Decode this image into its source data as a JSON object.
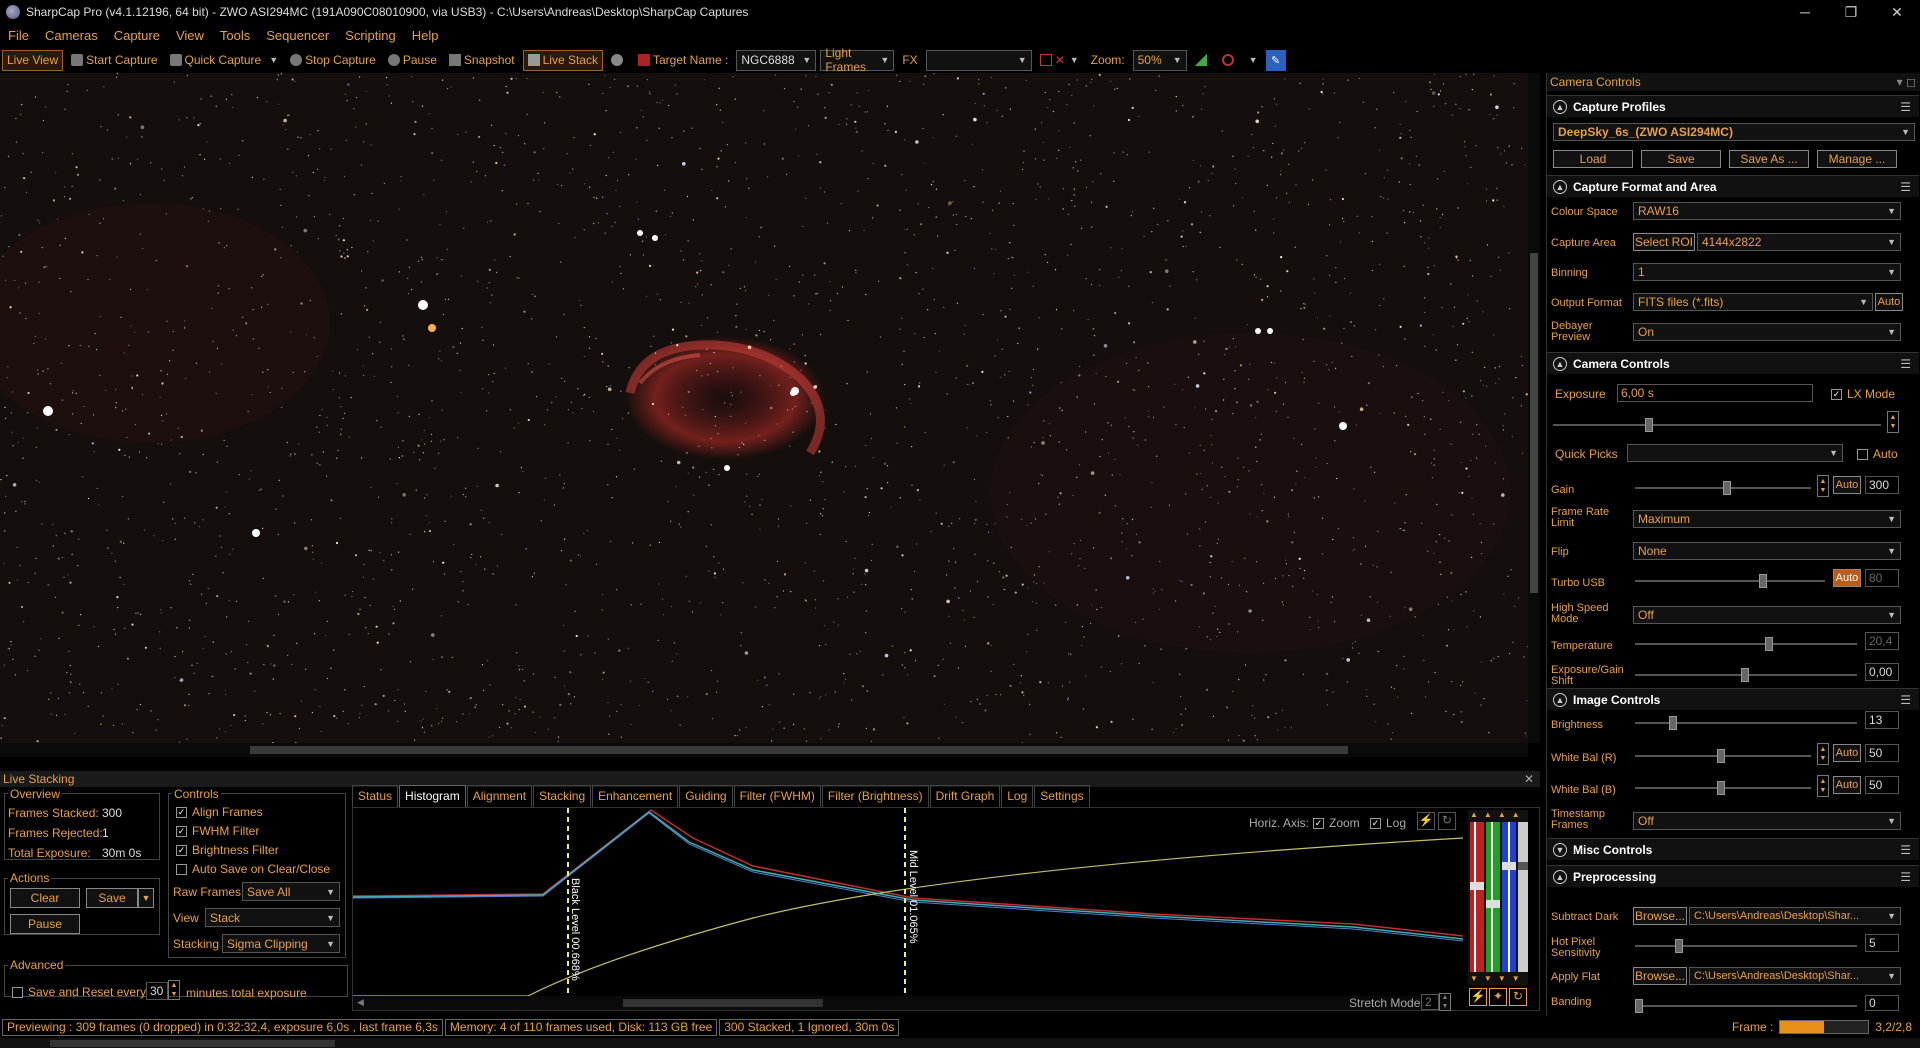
{
  "window": {
    "title": "SharpCap Pro (v4.1.12196, 64 bit) - ZWO ASI294MC (191A090C08010900, via USB3) - C:\\Users\\Andreas\\Desktop\\SharpCap Captures",
    "minimize": "─",
    "maximize": "❐",
    "close": "✕"
  },
  "menu": [
    "File",
    "Cameras",
    "Capture",
    "View",
    "Tools",
    "Sequencer",
    "Scripting",
    "Help"
  ],
  "toolbar": {
    "live_view": "Live View",
    "start_capture": "Start Capture",
    "quick_capture": "Quick Capture",
    "stop_capture": "Stop Capture",
    "pause": "Pause",
    "snapshot": "Snapshot",
    "live_stack": "Live Stack",
    "target_label": "Target Name :",
    "target_value": "NGC6888",
    "frame_type": "Light Frames",
    "fx_label": "FX",
    "fx_value": "",
    "zoom_label": "Zoom:",
    "zoom_value": "50%"
  },
  "live_stacking": {
    "header": "Live Stacking",
    "overview": {
      "title": "Overview",
      "frames_stacked_label": "Frames Stacked:",
      "frames_stacked": "300",
      "frames_rejected_label": "Frames Rejected:",
      "frames_rejected": "1",
      "total_exposure_label": "Total Exposure:",
      "total_exposure": "30m 0s"
    },
    "actions": {
      "title": "Actions",
      "clear": "Clear",
      "save": "Save",
      "pause": "Pause"
    },
    "advanced": {
      "title": "Advanced",
      "save_reset_label": "Save and Reset every",
      "minutes": "30",
      "minutes_label": "minutes total exposure"
    },
    "controls": {
      "title": "Controls",
      "align": "Align Frames",
      "align_checked": true,
      "fwhm": "FWHM Filter",
      "fwhm_checked": true,
      "brightness": "Brightness Filter",
      "brightness_checked": true,
      "autosave": "Auto Save on Clear/Close",
      "autosave_checked": false,
      "raw_frames_label": "Raw Frames",
      "raw_frames": "Save All",
      "view_label": "View",
      "view": "Stack",
      "stacking_label": "Stacking",
      "stacking": "Sigma Clipping"
    },
    "tabs": [
      "Status",
      "Histogram",
      "Alignment",
      "Stacking",
      "Enhancement",
      "Guiding",
      "Filter (FWHM)",
      "Filter (Brightness)",
      "Drift Graph",
      "Log",
      "Settings"
    ],
    "selected_tab": "Histogram",
    "histogram": {
      "horiz_axis_label": "Horiz. Axis:",
      "zoom": "Zoom",
      "zoom_checked": true,
      "log": "Log",
      "log_checked": true,
      "black_level": "Black Level 00.668%",
      "mid_level": "Mid Level 01.065%",
      "stretch_mode_label": "Stretch Mode",
      "stretch_mode": "2"
    }
  },
  "status": {
    "previewing": "Previewing : 309 frames (0 dropped) in 0:32:32,4, exposure 6,0s , last frame 6,3s",
    "memory": "Memory: 4 of 110 frames used, Disk: 113 GB free",
    "stacked": "300 Stacked, 1 Ignored, 30m 0s",
    "frame_label": "Frame :",
    "frame_value": "3,2/2,8",
    "frame_progress": 0.5
  },
  "camera_panel": {
    "header": "Camera Controls",
    "capture_profiles": {
      "title": "Capture Profiles",
      "profile": "DeepSky_6s_(ZWO ASI294MC)",
      "load": "Load",
      "save": "Save",
      "save_as": "Save As ...",
      "manage": "Manage ..."
    },
    "format": {
      "title": "Capture Format and Area",
      "colour_space_label": "Colour Space",
      "colour_space": "RAW16",
      "capture_area_label": "Capture Area",
      "select_roi": "Select ROI",
      "capture_area": "4144x2822",
      "binning_label": "Binning",
      "binning": "1",
      "output_format_label": "Output Format",
      "output_format": "FITS files (*.fits)",
      "auto": "Auto",
      "debayer_label": "Debayer Preview",
      "debayer": "On"
    },
    "camera": {
      "title": "Camera Controls",
      "exposure_label": "Exposure",
      "exposure": "6,00 s",
      "lx_mode": "LX Mode",
      "lx_checked": true,
      "quick_picks_label": "Quick Picks",
      "quick_picks": "",
      "auto": "Auto",
      "gain_label": "Gain",
      "gain": "300",
      "frame_rate_label": "Frame Rate Limit",
      "frame_rate": "Maximum",
      "flip_label": "Flip",
      "flip": "None",
      "turbo_label": "Turbo USB",
      "turbo": "80",
      "high_speed_label": "High Speed Mode",
      "high_speed": "Off",
      "temperature_label": "Temperature",
      "temperature": "20,4",
      "exp_gain_shift_label": "Exposure/Gain Shift",
      "exp_gain_shift": "0,00"
    },
    "image": {
      "title": "Image Controls",
      "brightness_label": "Brightness",
      "brightness": "13",
      "wb_r_label": "White Bal (R)",
      "wb_r": "50",
      "wb_b_label": "White Bal (B)",
      "wb_b": "50",
      "timestamp_label": "Timestamp Frames",
      "timestamp": "Off"
    },
    "misc": {
      "title": "Misc Controls"
    },
    "preprocessing": {
      "title": "Preprocessing",
      "subtract_dark_label": "Subtract Dark",
      "browse": "Browse...",
      "dark_path": "C:\\Users\\Andreas\\Desktop\\Shar...",
      "hot_pixel_label": "Hot Pixel Sensitivity",
      "hot_pixel": "5",
      "apply_flat_label": "Apply Flat",
      "flat_path": "C:\\Users\\Andreas\\Desktop\\Shar...",
      "banding_label": "Banding",
      "banding": "0"
    }
  },
  "colors": {
    "accent": "#e8a040",
    "background": "#000000",
    "nebula": "#c0302a"
  }
}
